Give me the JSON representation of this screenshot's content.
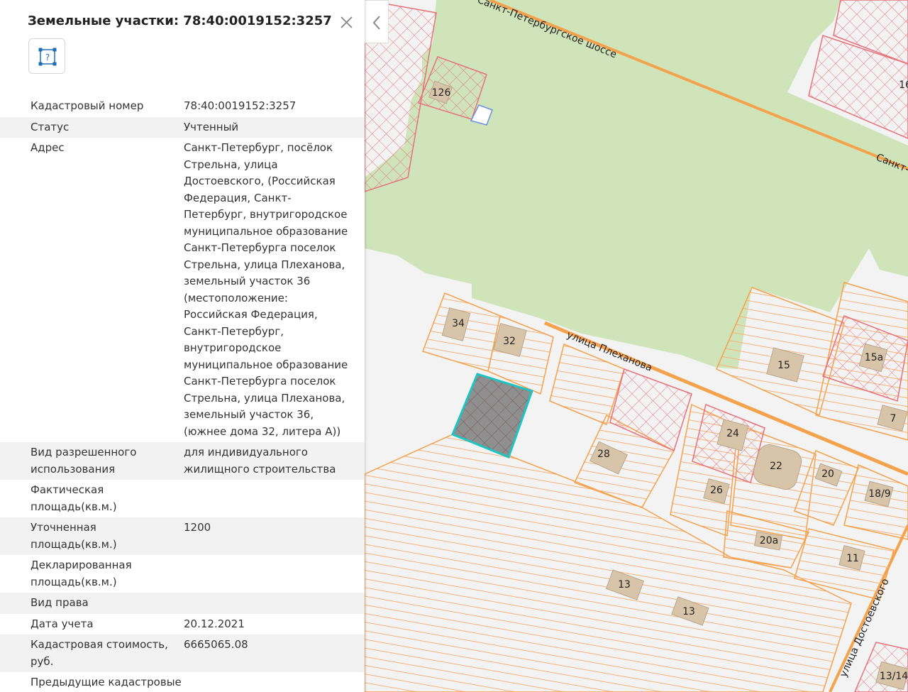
{
  "panel": {
    "title": "Земельные участки: 78:40:0019152:3257",
    "rows": [
      {
        "label": "Кадастровый номер",
        "value": "78:40:0019152:3257"
      },
      {
        "label": "Статус",
        "value": "Учтенный"
      },
      {
        "label": "Адрес",
        "value": "Санкт-Петербург, посёлок Стрельна, улица Достоевского, (Российская Федерация, Санкт-Петербург, внутригородское муниципальное образование Санкт-Петербурга поселок Стрельна, улица Плеханова, земельный участок 36 (местоположение: Российская Федерация, Санкт-Петербург, внутригородское муниципальное образование Санкт-Петербурга поселок Стрельна, улица Плеханова, земельный участок 36, (южнее дома 32, литера А))"
      },
      {
        "label": "Вид разрешенного использования",
        "value": "для индивидуального жилищного строительства"
      },
      {
        "label": "Фактическая площадь(кв.м.)",
        "value": ""
      },
      {
        "label": "Уточненная площадь(кв.м.)",
        "value": "1200"
      },
      {
        "label": "Декларированная площадь(кв.м.)",
        "value": ""
      },
      {
        "label": "Вид права",
        "value": ""
      },
      {
        "label": "Дата учета",
        "value": "20.12.2021"
      },
      {
        "label": "Кадастровая стоимость, руб.",
        "value": "6665065.08"
      },
      {
        "label": "Предыдущие кадастровые номера",
        "value": ""
      }
    ]
  },
  "map": {
    "streets": {
      "highway": "Санкт-Петербургское шоссе",
      "highway_right": "Санкт-П",
      "plekhanova": "улица Плеханова",
      "dostoevskogo": "улица Достоевского"
    },
    "house_numbers": {
      "h126": "126",
      "h16": "16",
      "h34": "34",
      "h32": "32",
      "h15": "15",
      "h15a": "15а",
      "h7": "7",
      "h24": "24",
      "h22": "22",
      "h20": "20",
      "h18_9": "18/9",
      "h28": "28",
      "h26": "26",
      "h20a": "20а",
      "h11": "11",
      "h13a": "13",
      "h13b": "13",
      "h13_14": "13/14"
    },
    "colors": {
      "parcel": "#f5a04a",
      "restricted": "#e8707a",
      "selected": "#1ec4c4",
      "park": "#cfe4b8",
      "road": "#f5a24d",
      "building": "#d8c4a8"
    }
  }
}
